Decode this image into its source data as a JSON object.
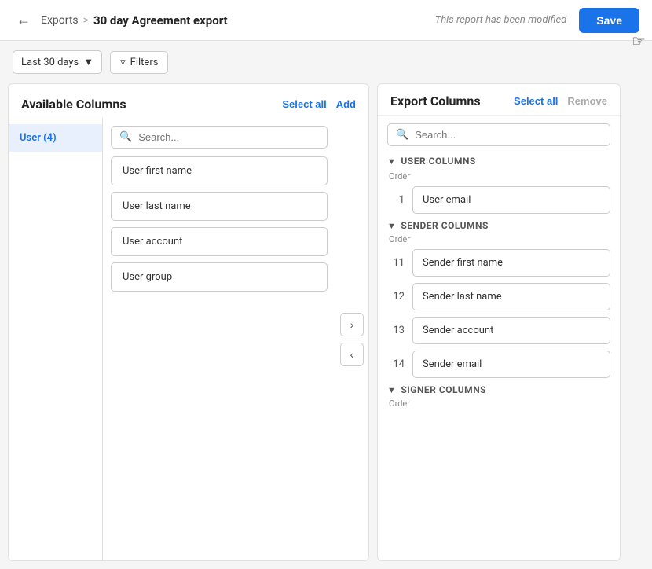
{
  "header": {
    "back_label": "←",
    "breadcrumb_parent": "Exports",
    "breadcrumb_sep": ">",
    "breadcrumb_current": "30 day Agreement export",
    "modified_text": "This report has been modified",
    "save_label": "Save"
  },
  "filterbar": {
    "date_range": "Last 30 days",
    "filters_label": "Filters"
  },
  "left_panel": {
    "title": "Available Columns",
    "select_all_label": "Select all",
    "add_label": "Add",
    "search_placeholder": "Search...",
    "categories": [
      {
        "label": "User (4)",
        "active": true
      }
    ],
    "items": [
      {
        "label": "User first name"
      },
      {
        "label": "User last name"
      },
      {
        "label": "User account"
      },
      {
        "label": "User group"
      }
    ]
  },
  "arrow_buttons": {
    "right": "›",
    "left": "‹"
  },
  "right_panel": {
    "title": "Export Columns",
    "select_all_label": "Select all",
    "remove_label": "Remove",
    "search_placeholder": "Search...",
    "sections": [
      {
        "id": "user",
        "label": "USER COLUMNS",
        "order_label": "Order",
        "items": [
          {
            "order": "1",
            "label": "User email"
          }
        ]
      },
      {
        "id": "sender",
        "label": "SENDER COLUMNS",
        "order_label": "Order",
        "items": [
          {
            "order": "11",
            "label": "Sender first name"
          },
          {
            "order": "12",
            "label": "Sender last name"
          },
          {
            "order": "13",
            "label": "Sender account"
          },
          {
            "order": "14",
            "label": "Sender email"
          }
        ]
      },
      {
        "id": "signer",
        "label": "SIGNER COLUMNS",
        "order_label": "Order",
        "items": []
      }
    ]
  }
}
